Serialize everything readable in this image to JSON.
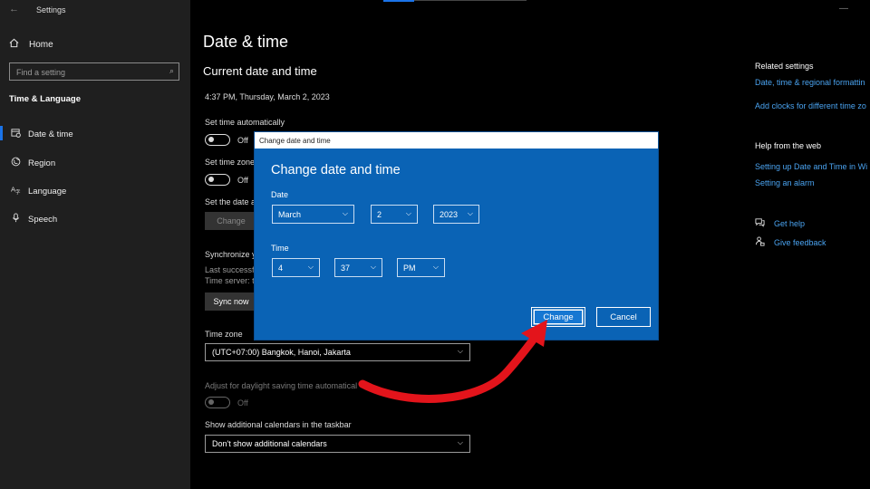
{
  "window": {
    "title": "Settings",
    "back_icon": "back-arrow-icon",
    "controls": [
      "—",
      "☐",
      "✕"
    ]
  },
  "sidebar": {
    "home_label": "Home",
    "search_placeholder": "Find a setting",
    "section_title": "Time & Language",
    "items": [
      {
        "label": "Date & time",
        "icon": "calendar-clock-icon",
        "active": true
      },
      {
        "label": "Region",
        "icon": "globe-icon",
        "active": false
      },
      {
        "label": "Language",
        "icon": "language-icon",
        "active": false
      },
      {
        "label": "Speech",
        "icon": "microphone-icon",
        "active": false
      }
    ],
    "accent": "#1a73e8"
  },
  "main": {
    "page_title": "Date & time",
    "subheading": "Current date and time",
    "current_datetime": "4:37 PM, Thursday, March 2, 2023",
    "set_time_auto_label": "Set time automatically",
    "set_time_auto_state": "Off",
    "set_timezone_auto_label": "Set time zone",
    "set_timezone_auto_state": "Off",
    "set_date_manual_label": "Set the date a",
    "change_button": "Change",
    "sync_label": "Synchronize y",
    "last_sync": "Last successfu",
    "time_server": "Time server: t",
    "sync_button": "Sync now",
    "timezone_label": "Time zone",
    "timezone_value": "(UTC+07:00) Bangkok, Hanoi, Jakarta",
    "dst_label": "Adjust for daylight saving time automatical",
    "dst_state": "Off",
    "calendars_label": "Show additional calendars in the taskbar",
    "calendars_value": "Don't show additional calendars"
  },
  "right_panel": {
    "related_title": "Related settings",
    "related_links": [
      "Date, time & regional formattin",
      "Add clocks for different time zo"
    ],
    "help_title": "Help from the web",
    "help_links": [
      "Setting up Date and Time in Wi",
      "Setting an alarm"
    ],
    "get_help": "Get help",
    "give_feedback": "Give feedback",
    "link_color": "#4aa3f0"
  },
  "dialog": {
    "window_title": "Change date and time",
    "heading": "Change date and time",
    "date_label": "Date",
    "month": "March",
    "day": "2",
    "year": "2023",
    "time_label": "Time",
    "hour": "4",
    "minute": "37",
    "ampm": "PM",
    "change_button": "Change",
    "cancel_button": "Cancel",
    "background": "#0a63b5"
  },
  "annotation": {
    "arrow_color": "#e3141b",
    "points_to": "change-button"
  }
}
